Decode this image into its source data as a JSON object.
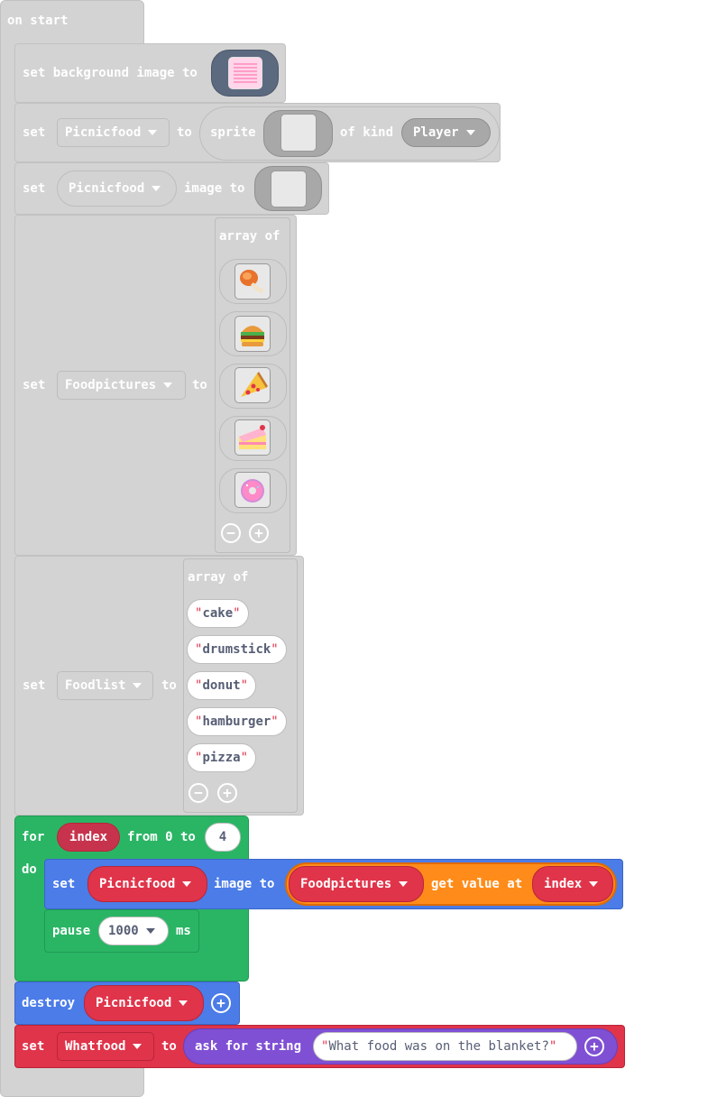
{
  "hat": {
    "label": "on start"
  },
  "bg_block": {
    "set": "set background image to",
    "image_icon": "pink-grid-image-icon"
  },
  "sprite_block": {
    "set": "set",
    "variable": "Picnicfood",
    "to": "to",
    "sprite": "sprite",
    "of_kind": "of kind",
    "kind": "Player"
  },
  "image_block": {
    "set": "set",
    "variable": "Picnicfood",
    "image_to": "image to"
  },
  "foodpictures_block": {
    "set": "set",
    "variable": "Foodpictures",
    "to": "to",
    "array_of": "array of",
    "images": [
      "drumstick-icon",
      "hamburger-icon",
      "pizza-icon",
      "cake-icon",
      "donut-icon"
    ]
  },
  "foodlist_block": {
    "set": "set",
    "variable": "Foodlist",
    "to": "to",
    "array_of": "array of",
    "items": [
      "cake",
      "drumstick",
      "donut",
      "hamburger",
      "pizza"
    ]
  },
  "for_block": {
    "for": "for",
    "var": "index",
    "from": "from 0 to",
    "to_value": "4",
    "do": "do"
  },
  "inner_set": {
    "set": "set",
    "variable": "Picnicfood",
    "image_to": "image to",
    "array": "Foodpictures",
    "get": "get value at",
    "index": "index"
  },
  "pause": {
    "label": "pause",
    "value": "1000",
    "unit": "ms"
  },
  "destroy": {
    "label": "destroy",
    "variable": "Picnicfood"
  },
  "ask": {
    "set": "set",
    "variable": "Whatfood",
    "to": "to",
    "ask": "ask for string",
    "prompt": "What food was on the blanket?"
  },
  "colors": {
    "gray": "#d3d3d3",
    "green": "#2ab565",
    "blue": "#4b7ce8",
    "red": "#e0344a",
    "orange": "#ff8c1a",
    "purple": "#7f4fd4"
  }
}
